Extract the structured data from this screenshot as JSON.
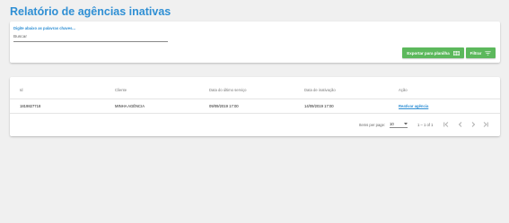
{
  "page": {
    "title": "Relatório de agências inativas"
  },
  "filter": {
    "search_label": "Digite abaixo as palavras chaves...",
    "search_placeholder": "Buscar",
    "search_value": "",
    "export_label": "Exportar para planilha",
    "export_icon": "spreadsheet-icon",
    "filter_label": "Filtrar",
    "filter_icon": "funnel-icon"
  },
  "table": {
    "columns": [
      "Id",
      "Cliente",
      "Data do último serviço",
      "Data de inativação",
      "Ação"
    ],
    "rows": [
      {
        "id": "1819827718",
        "cliente": "MINHA AGÊNCIA",
        "ultimo_servico": "09/09/2019 17:00",
        "inativacao": "14/09/2019 17:00",
        "acao": "Reativar agência"
      }
    ]
  },
  "pagination": {
    "items_per_page_label": "Items per page:",
    "items_per_page_value": "10",
    "range_label": "1 – 1 of 1",
    "icons": [
      "first-page-icon",
      "previous-page-icon",
      "next-page-icon",
      "last-page-icon"
    ]
  },
  "colors": {
    "accent": "#2f8fd4",
    "button": "#5cb85c",
    "background": "#f0f0f0"
  }
}
